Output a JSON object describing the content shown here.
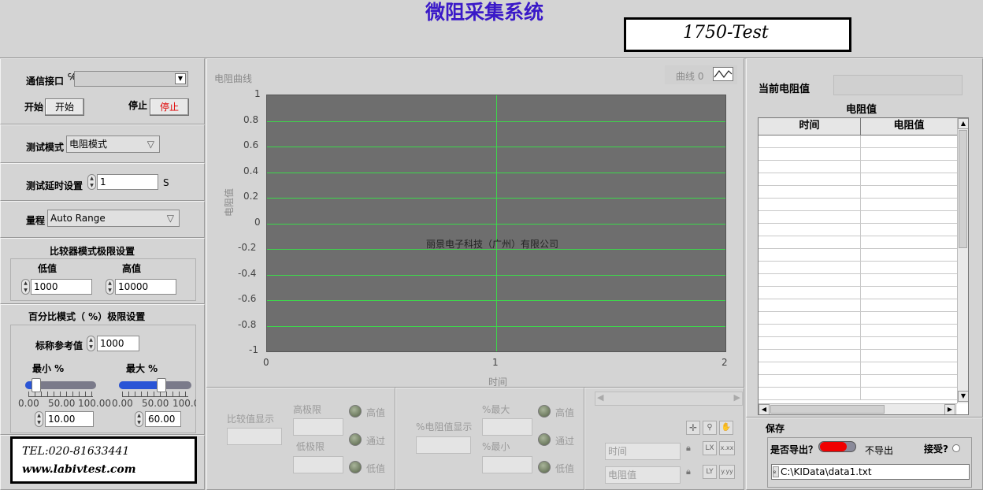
{
  "app_title": "微阻采集系统",
  "device_label": "1750-Test",
  "comm": {
    "label": "通信接口",
    "prefix": "℅",
    "value": ""
  },
  "start": {
    "label": "开始",
    "button": "开始"
  },
  "stop": {
    "label": "停止",
    "button": "停止"
  },
  "test_mode": {
    "label": "测试模式",
    "value": "电阻模式"
  },
  "delay": {
    "label": "测试延时设置",
    "value": "1",
    "unit": "S"
  },
  "range": {
    "label": "量程",
    "value": "Auto Range"
  },
  "comparator": {
    "title": "比较器模式极限设置",
    "low_label": "低值",
    "low_value": "1000",
    "high_label": "高值",
    "high_value": "10000"
  },
  "percent": {
    "title": "百分比模式（ %）极限设置",
    "ref_label": "标称参考值",
    "ref_value": "1000",
    "min_label": "最小 %",
    "max_label": "最大 %",
    "min_ticks": [
      "0.00",
      "50.00",
      "100.00"
    ],
    "max_ticks": [
      "0.00",
      "50.00",
      "100.0"
    ],
    "min_value": "10.00",
    "max_value": "60.00",
    "min_level": 0.1,
    "max_level": 0.6
  },
  "contact": {
    "tel": "TEL:020-81633441",
    "web": "www.labivtest.com"
  },
  "chart_panel": {
    "title": "电阻曲线",
    "legend": "曲线 0",
    "watermark": "丽景电子科技（广州）有限公司"
  },
  "chart_data": {
    "type": "line",
    "xlabel": "时间",
    "ylabel": "电阻值",
    "xlim": [
      0,
      2
    ],
    "ylim": [
      -1,
      1
    ],
    "x_ticks": [
      "0",
      "1",
      "2"
    ],
    "y_ticks": [
      "1",
      "0.8",
      "0.6",
      "0.4",
      "0.2",
      "0",
      "-0.2",
      "-0.4",
      "-0.6",
      "-0.8",
      "-1"
    ],
    "grid": true,
    "series": [
      {
        "name": "曲线 0",
        "values": []
      }
    ]
  },
  "compare_display": {
    "label": "比较值显示",
    "upper_label": "高极限",
    "lower_label": "低极限",
    "led_high": "高值",
    "led_pass": "通过",
    "led_low": "低值"
  },
  "percent_display": {
    "label": "%电阻值显示",
    "max_label": "%最大",
    "min_label": "%最小",
    "led_high": "高值",
    "led_pass": "通过",
    "led_low": "低值"
  },
  "cursor": {
    "time_label": "时间",
    "resistance_label": "电阻值"
  },
  "current": {
    "label": "当前电阻值",
    "value": ""
  },
  "table": {
    "title": "电阻值",
    "columns": [
      "时间",
      "电阻值"
    ],
    "rows": 21
  },
  "save": {
    "title": "保存",
    "export_label": "是否导出？",
    "export_state": "不导出",
    "accept_label": "接受?",
    "path": "C:\\KIData\\data1.txt"
  },
  "colors": {
    "plot_bg": "#6e6e6e",
    "grid": "#3dd84b",
    "title": "#3a19c8",
    "stop_text": "#e00000"
  }
}
